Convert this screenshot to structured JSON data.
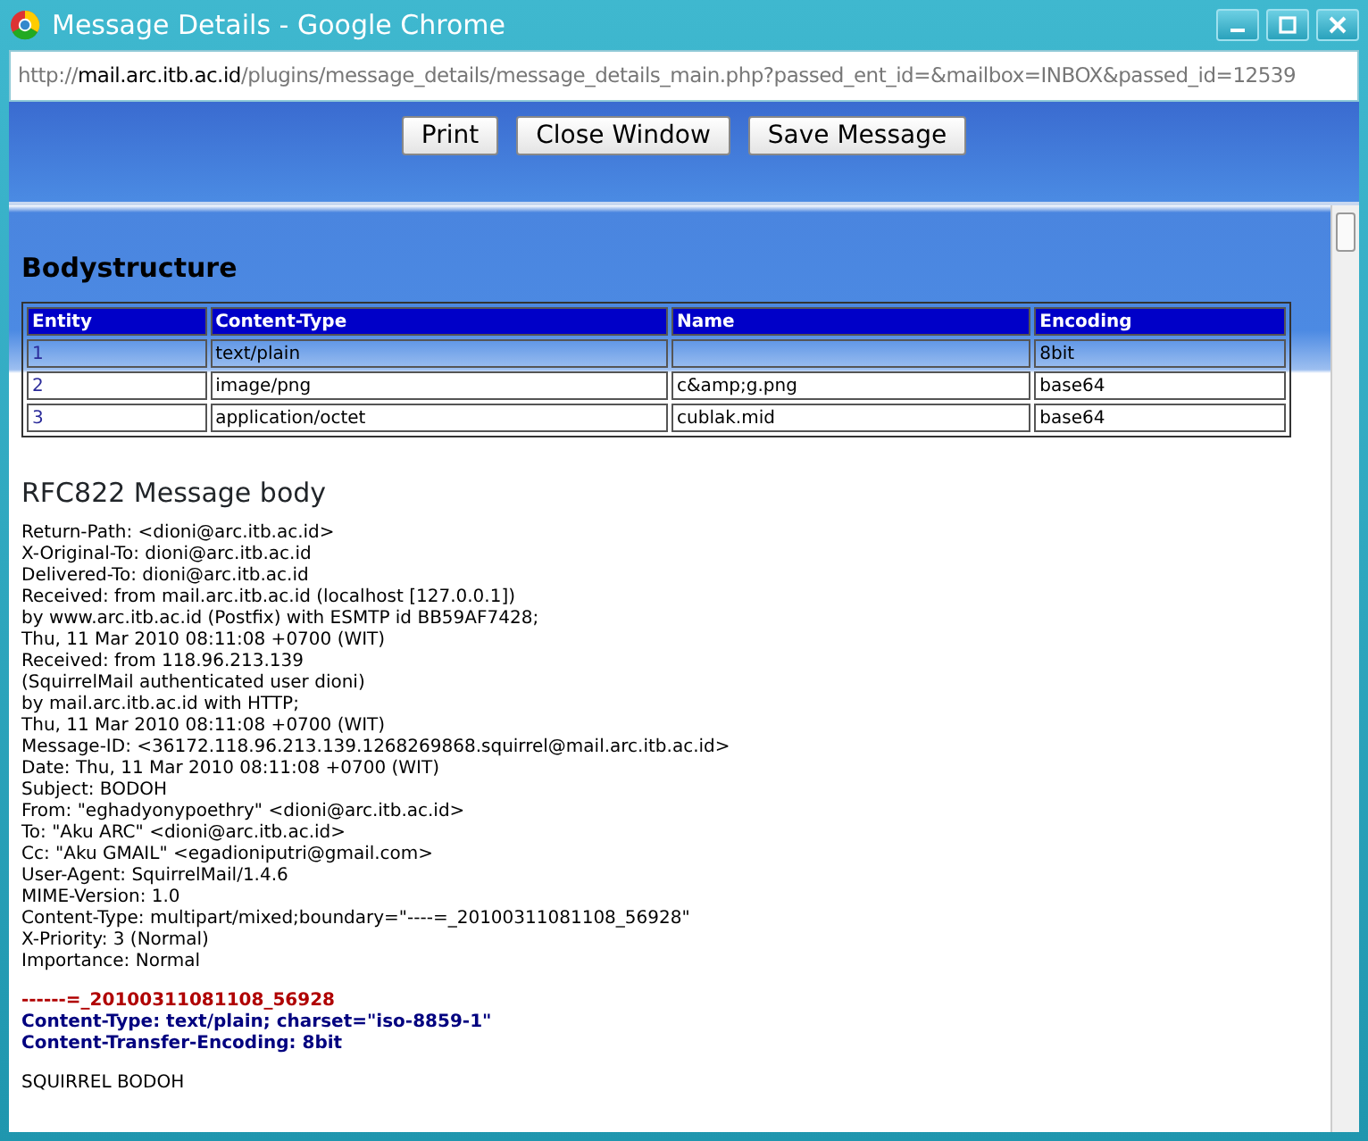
{
  "window": {
    "title": "Message Details - Google Chrome"
  },
  "address": {
    "scheme": "http://",
    "host": "mail.arc.itb.ac.id",
    "path": "/plugins/message_details/message_details_main.php?passed_ent_id=&mailbox=INBOX&passed_id=12539"
  },
  "buttons": [
    "Print",
    "Close Window",
    "Save Message"
  ],
  "bodystructure": {
    "heading": "Bodystructure",
    "columns": [
      "Entity",
      "Content-Type",
      "Name",
      "Encoding"
    ],
    "rows": [
      [
        "1",
        "text/plain",
        "",
        "8bit"
      ],
      [
        "2",
        "image/png",
        "c&amp;g.png",
        "base64"
      ],
      [
        "3",
        "application/octet",
        "cublak.mid",
        "base64"
      ]
    ]
  },
  "message_body": {
    "heading": "RFC822 Message body",
    "headers": [
      "Return-Path: <dioni@arc.itb.ac.id>",
      "X-Original-To: dioni@arc.itb.ac.id",
      "Delivered-To: dioni@arc.itb.ac.id",
      "Received: from mail.arc.itb.ac.id (localhost [127.0.0.1])",
      "by www.arc.itb.ac.id (Postfix) with ESMTP id BB59AF7428;",
      "Thu, 11 Mar 2010 08:11:08 +0700 (WIT)",
      "Received: from 118.96.213.139",
      "(SquirrelMail authenticated user dioni)",
      "by mail.arc.itb.ac.id with HTTP;",
      "Thu, 11 Mar 2010 08:11:08 +0700 (WIT)",
      "Message-ID: <36172.118.96.213.139.1268269868.squirrel@mail.arc.itb.ac.id>",
      "Date: Thu, 11 Mar 2010 08:11:08 +0700 (WIT)",
      "Subject: BODOH",
      "From: \"eghadyonypoethry\" <dioni@arc.itb.ac.id>",
      "To: \"Aku ARC\" <dioni@arc.itb.ac.id>",
      "Cc: \"Aku GMAIL\" <egadioniputri@gmail.com>",
      "User-Agent: SquirrelMail/1.4.6",
      "MIME-Version: 1.0",
      "Content-Type: multipart/mixed;boundary=\"----=_20100311081108_56928\"",
      "X-Priority: 3 (Normal)",
      "Importance: Normal"
    ],
    "boundary": "------=_20100311081108_56928",
    "part_headers": [
      "Content-Type: text/plain; charset=\"iso-8859-1\"",
      "Content-Transfer-Encoding: 8bit"
    ],
    "body": [
      "SQUIRREL BODOH"
    ]
  }
}
